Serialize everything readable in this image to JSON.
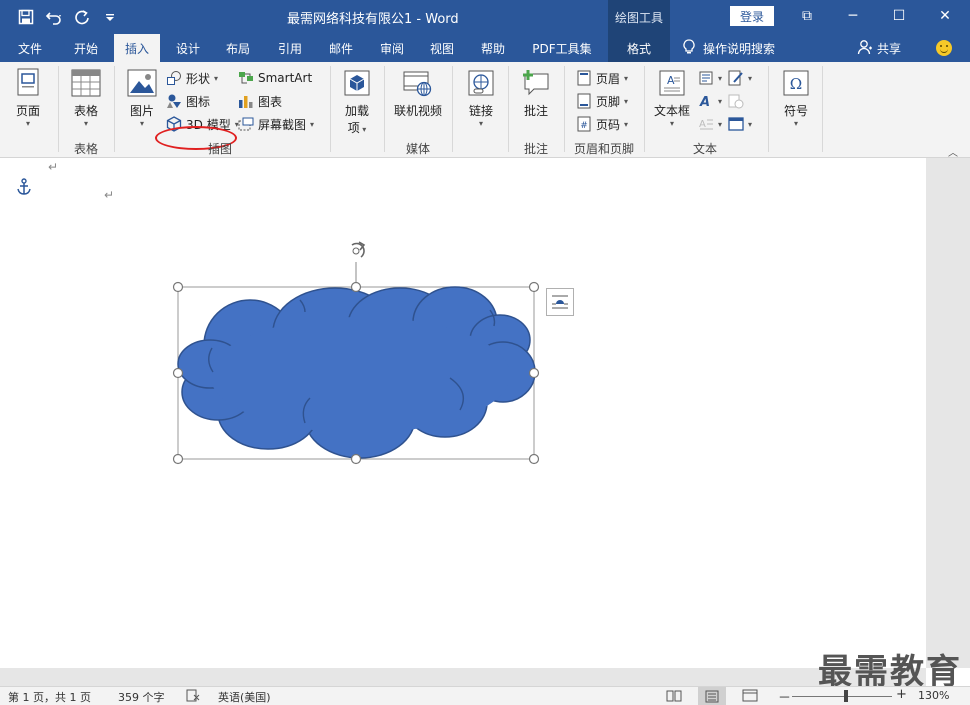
{
  "title_bar": {
    "doc_title": "最需网络科技有限公1  -  Word",
    "context_tab": "绘图工具",
    "login": "登录",
    "minimize_glyph": "─",
    "restore_glyph": "☐",
    "close_glyph": "✕",
    "ribbon_display_glyph": "⧉"
  },
  "quick_access": {
    "save_icon": "save-icon",
    "undo_icon": "undo-icon",
    "redo_icon": "redo-icon",
    "customize_icon": "customize-icon"
  },
  "tabs": [
    {
      "label": "文件"
    },
    {
      "label": "开始"
    },
    {
      "label": "插入"
    },
    {
      "label": "设计"
    },
    {
      "label": "布局"
    },
    {
      "label": "引用"
    },
    {
      "label": "邮件"
    },
    {
      "label": "审阅"
    },
    {
      "label": "视图"
    },
    {
      "label": "帮助"
    },
    {
      "label": "PDF工具集"
    },
    {
      "label": "格式"
    }
  ],
  "active_tab": "插入",
  "tell_me": "操作说明搜索",
  "share": "共享",
  "ribbon": {
    "pages": {
      "button": "页面"
    },
    "tables": {
      "button": "表格",
      "group": "表格"
    },
    "illustrations": {
      "picture": "图片",
      "shapes": "形状",
      "icons": "图标",
      "model3d": "3D 模型",
      "smartart": "SmartArt",
      "chart": "图表",
      "screenshot": "屏幕截图",
      "group": "插图"
    },
    "addins": {
      "button_line1": "加载",
      "button_line2": "项"
    },
    "media": {
      "button": "联机视频",
      "group": "媒体"
    },
    "links": {
      "button": "链接"
    },
    "comments": {
      "button": "批注",
      "group": "批注"
    },
    "header_footer": {
      "header": "页眉",
      "footer": "页脚",
      "page_number": "页码",
      "group": "页眉和页脚"
    },
    "text": {
      "textbox": "文本框",
      "group": "文本"
    },
    "symbols": {
      "button": "符号"
    }
  },
  "colors": {
    "accent": "#2b579a",
    "shape_fill": "#4472c4",
    "shape_stroke": "#2f528f",
    "highlight_circle": "#e02020"
  },
  "document": {
    "paragraph_mark": "↵",
    "anchor_icon": "anchor-icon"
  },
  "watermark": "最需教育",
  "status": {
    "page": "第 1 页，共 1 页",
    "words": "359 个字",
    "language": "英语(美国)",
    "zoom": "130%",
    "zoom_minus": "－",
    "zoom_plus": "+"
  }
}
